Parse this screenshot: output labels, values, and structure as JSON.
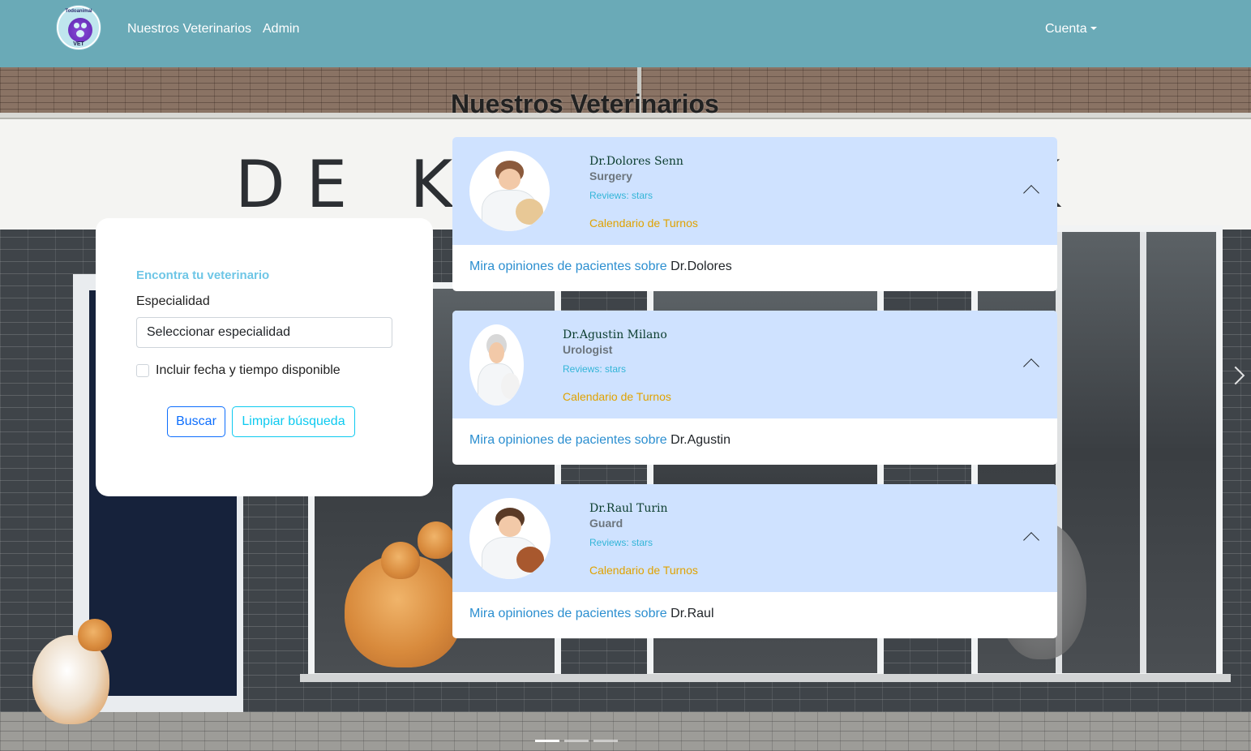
{
  "nav": {
    "logo": {
      "top_text": "Todoanimal",
      "bottom_text": "VET"
    },
    "links": [
      "Nuestros Veterinarios",
      "Admin"
    ],
    "account": "Cuenta"
  },
  "hero": {
    "sign_left": "DE KA",
    "sign_right": "K"
  },
  "page_title": "Nuestros Veterinarios",
  "search": {
    "heading": "Encontra tu veterinario",
    "specialty_label": "Especialidad",
    "specialty_value": "Seleccionar especialidad",
    "include_checkbox_label": "Incluir fecha y tiempo disponible",
    "search_button": "Buscar",
    "clear_button": "Limpiar búsqueda"
  },
  "vets": [
    {
      "name": "Dr.Dolores Senn",
      "specialty": "Surgery",
      "reviews": "Reviews: stars",
      "calendar": "Calendario de Turnos",
      "opinions_prefix": "Mira opiniones de pacientes sobre",
      "opinions_name": "Dr.Dolores"
    },
    {
      "name": "Dr.Agustin Milano",
      "specialty": "Urologist",
      "reviews": "Reviews: stars",
      "calendar": "Calendario de Turnos",
      "opinions_prefix": "Mira opiniones de pacientes sobre",
      "opinions_name": "Dr.Agustin"
    },
    {
      "name": "Dr.Raul Turin",
      "specialty": "Guard",
      "reviews": "Reviews: stars",
      "calendar": "Calendario de Turnos",
      "opinions_prefix": "Mira opiniones de pacientes sobre",
      "opinions_name": "Dr.Raul"
    }
  ],
  "carousel": {
    "slides": 3,
    "active_slide": 1
  },
  "colors": {
    "navbar": "#6aaab7",
    "card_header": "#cfe2ff",
    "heading_accent": "#6ec6e6",
    "calendar_link": "#e0a200",
    "reviews_text": "#33b5d8",
    "primary_button": "#0d6efd",
    "info_button": "#0dcaf0"
  },
  "icons": {
    "logo": "paw-logo-icon",
    "account_dropdown": "caret-down-icon",
    "card_toggle": "chevron-up-icon",
    "carousel_next": "chevron-right-icon"
  }
}
